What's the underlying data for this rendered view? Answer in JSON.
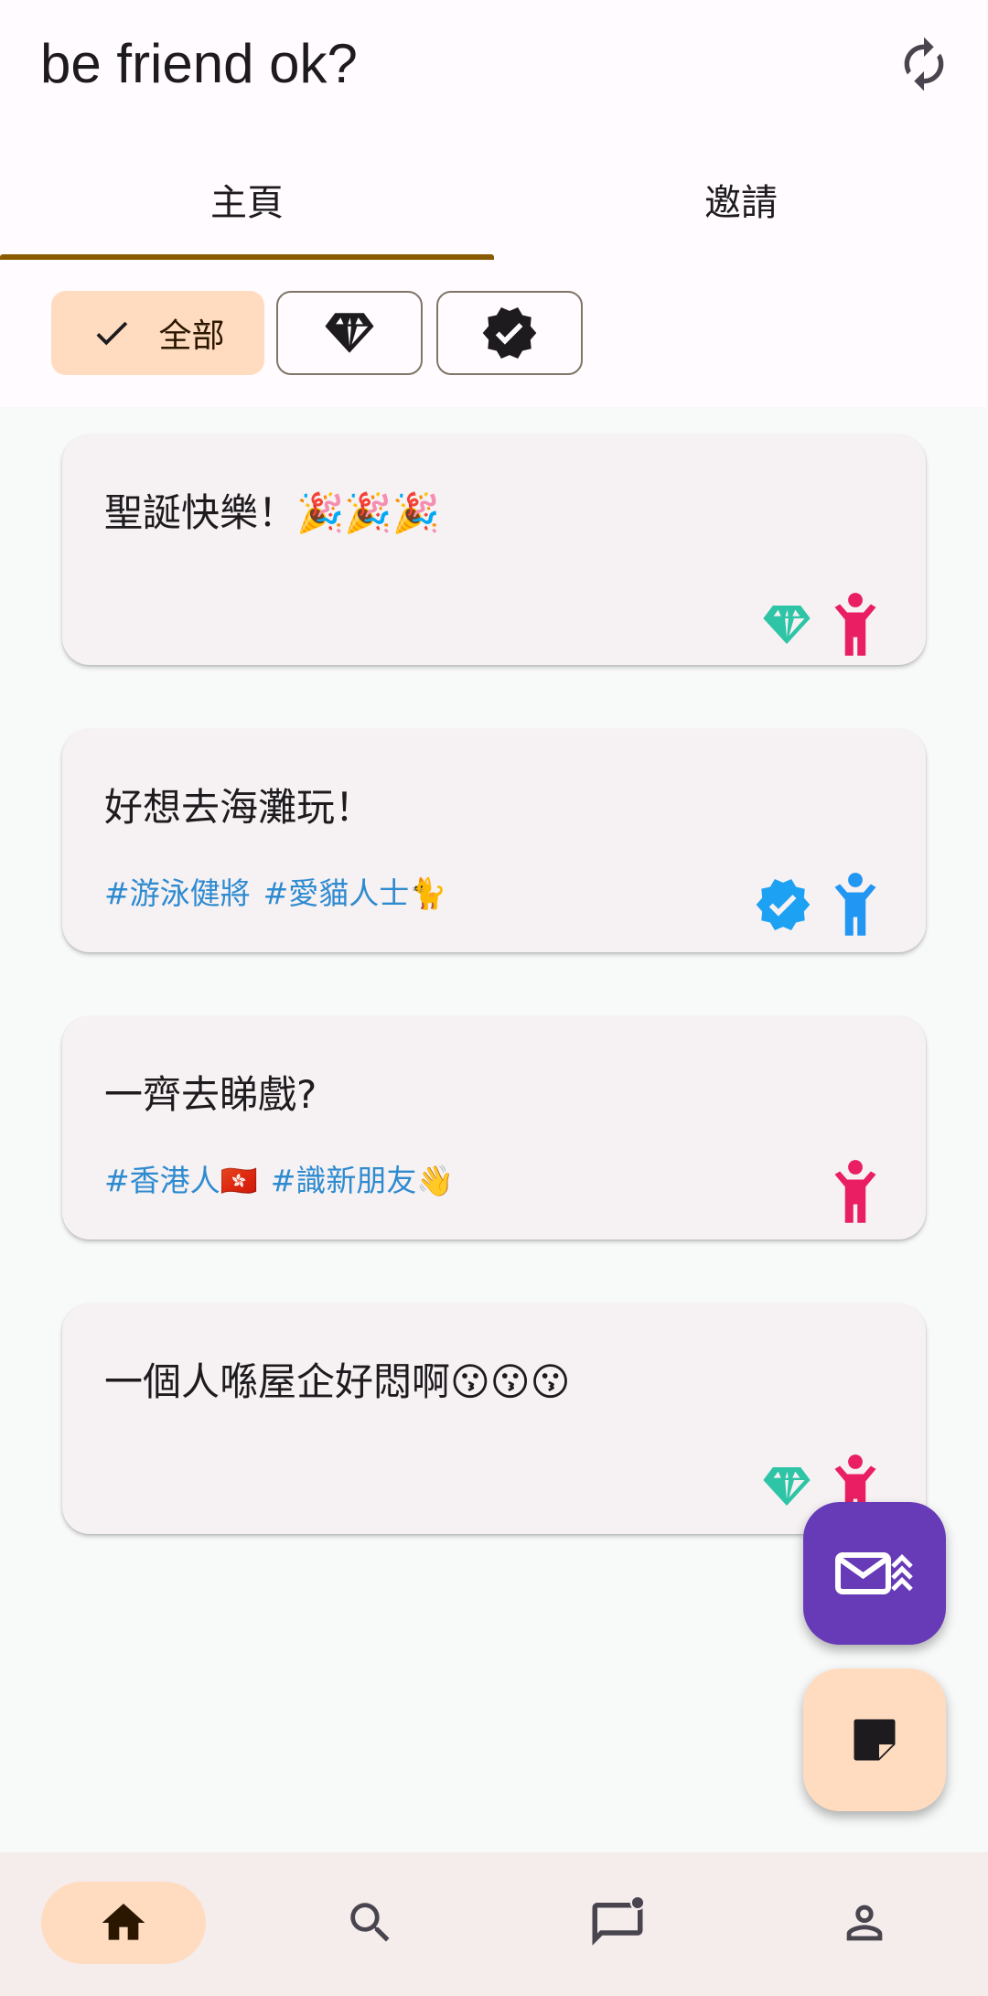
{
  "app": {
    "title": "be friend ok?"
  },
  "tabs": [
    {
      "label": "主頁",
      "selected": true
    },
    {
      "label": "邀請",
      "selected": false
    }
  ],
  "filters": {
    "all_label": "全部",
    "selected": "all"
  },
  "posts": [
    {
      "text": "聖誕快樂！🎉🎉🎉",
      "tags": [],
      "badge": "diamond",
      "gender": "female"
    },
    {
      "text": "好想去海灘玩！",
      "tags": [
        "#游泳健將",
        "#愛貓人士🐈"
      ],
      "badge": "verified",
      "gender": "male"
    },
    {
      "text": "一齊去睇戲?",
      "tags": [
        "#香港人🇭🇰",
        "#識新朋友👋"
      ],
      "badge": "none",
      "gender": "female"
    },
    {
      "text": "一個人喺屋企好悶啊😗😗😗",
      "tags": [],
      "badge": "diamond",
      "gender": "female"
    }
  ],
  "colors": {
    "accent": "#8a5a00",
    "chip_selected": "#ffdcc0",
    "card_bg": "#f6f1f3",
    "tag_text": "#2e8bd0",
    "diamond": "#2ec4a6",
    "verified": "#1da1f2",
    "female": "#e91e63",
    "male": "#2196f3",
    "fab_invite": "#673ab7",
    "fab_post": "#ffdcc0"
  },
  "nav": {
    "items": [
      {
        "icon": "home-icon",
        "selected": true
      },
      {
        "icon": "search-icon",
        "selected": false
      },
      {
        "icon": "chat-icon",
        "selected": false,
        "unread_dot": true
      },
      {
        "icon": "person-icon",
        "selected": false
      }
    ]
  }
}
